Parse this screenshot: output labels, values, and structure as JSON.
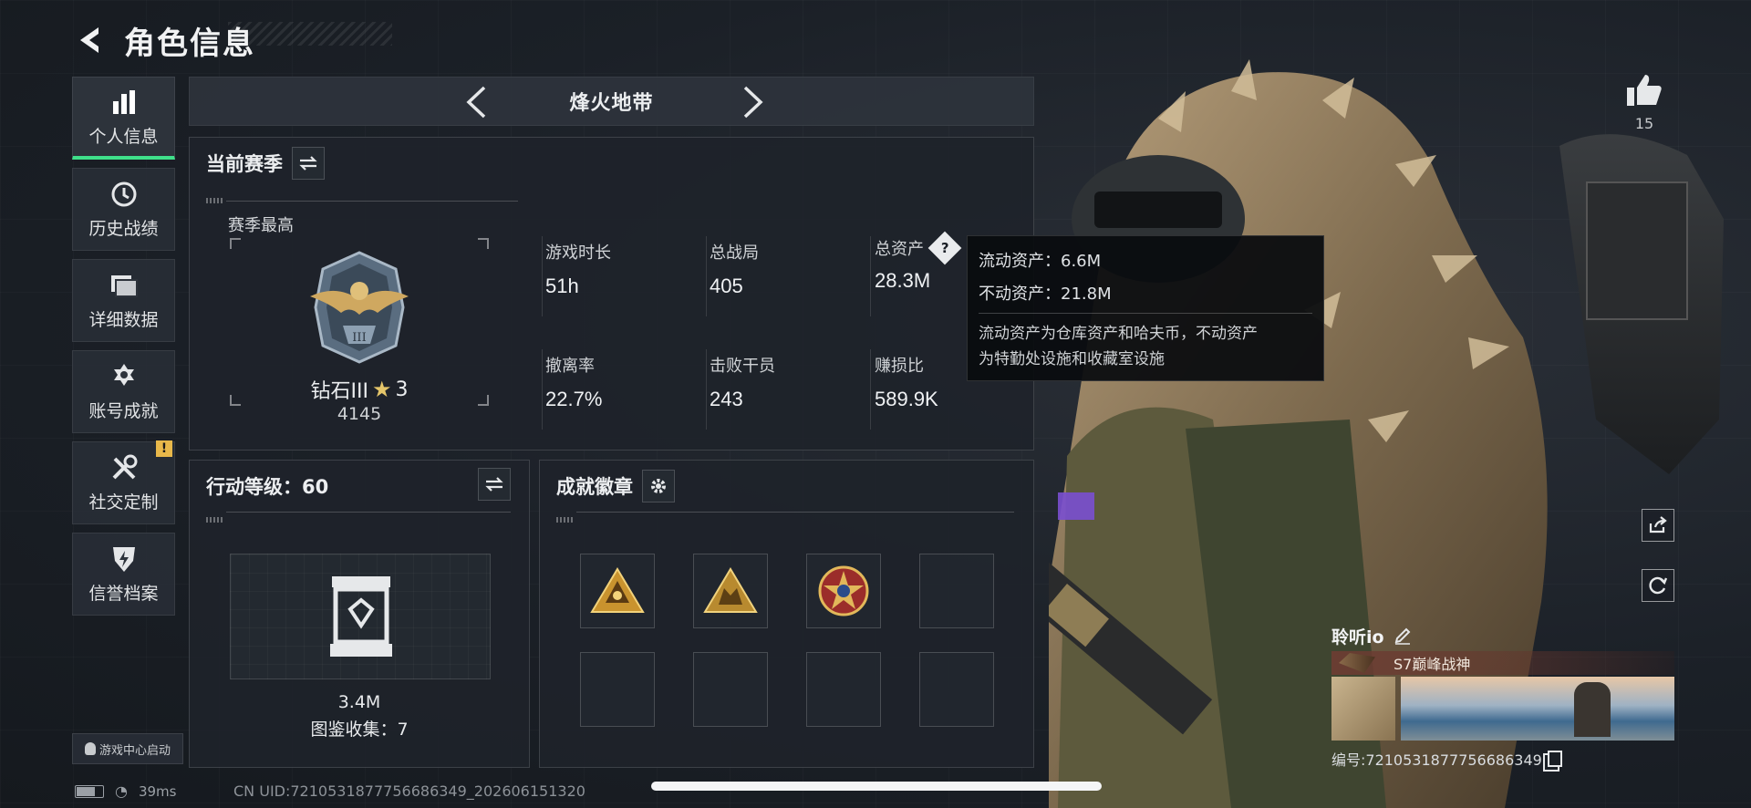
{
  "header": {
    "title": "角色信息"
  },
  "sidebar": {
    "items": [
      {
        "label": "个人信息",
        "icon": "bar-chart-icon",
        "active": true
      },
      {
        "label": "历史战绩",
        "icon": "history-icon"
      },
      {
        "label": "详细数据",
        "icon": "folder-icon"
      },
      {
        "label": "账号成就",
        "icon": "medal-icon"
      },
      {
        "label": "社交定制",
        "icon": "tools-icon",
        "badge": "!"
      },
      {
        "label": "信誉档案",
        "icon": "shield-bolt-icon"
      }
    ],
    "game_center": "游戏中心启动"
  },
  "mode": {
    "title": "烽火地带"
  },
  "season": {
    "title": "当前赛季",
    "best_label": "赛季最高",
    "rank_name": "钻石III",
    "rank_stars": "3",
    "rank_score": "4145",
    "stats": [
      {
        "label": "游戏时长",
        "value": "51h"
      },
      {
        "label": "总战局",
        "value": "405"
      },
      {
        "label": "总资产",
        "value": "28.3M"
      },
      {
        "label": "撤离率",
        "value": "22.7%"
      },
      {
        "label": "击败干员",
        "value": "243"
      },
      {
        "label": "赚损比",
        "value": "589.9K"
      }
    ]
  },
  "tooltip": {
    "liquid": "流动资产：6.6M",
    "fixed": "不动资产：21.8M",
    "desc_line1": "流动资产为仓库资产和哈夫币，不动资产",
    "desc_line2": "为特勤处设施和收藏室设施"
  },
  "level": {
    "title": "行动等级：60",
    "value": "3.4M",
    "collection": "图鉴收集：7"
  },
  "achievements": {
    "title": "成就徽章"
  },
  "like": {
    "count": "15"
  },
  "card": {
    "name": "聆听io",
    "title": "S7巅峰战神",
    "uid": "编号:7210531877756686349"
  },
  "status": {
    "ping": "39ms"
  },
  "footer": {
    "uid": "CN UID:7210531877756686349_202606151320"
  },
  "colors": {
    "accent": "#3fe08a",
    "warning": "#e8b84a"
  }
}
